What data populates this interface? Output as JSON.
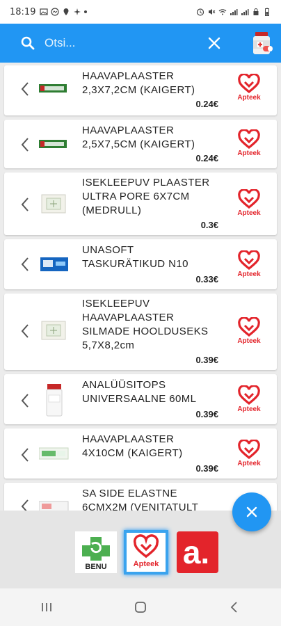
{
  "status_bar": {
    "time": "18:19"
  },
  "search": {
    "placeholder": "Otsi...",
    "value": ""
  },
  "colors": {
    "primary": "#2196f3",
    "apteek_red": "#e3242b",
    "card_bg": "#ffffff"
  },
  "products": [
    {
      "name": "HAAVAPLAASTER\n2,3X7,2CM (KAIGERT)",
      "price": "0.24€",
      "thumb": "green-strip",
      "pharmacy": "Apteek"
    },
    {
      "name": "HAAVAPLAASTER\n2,5X7,5CM (KAIGERT)",
      "price": "0.24€",
      "thumb": "green-strip",
      "pharmacy": "Apteek"
    },
    {
      "name": "ISEKLEEPUV PLAASTER\nULTRA PORE 6X7CM\n(MEDRULL)",
      "price": "0.3€",
      "thumb": "pad",
      "pharmacy": "Apteek"
    },
    {
      "name": "UNASOFT\nTASKURÄTIKUD N10",
      "price": "0.33€",
      "thumb": "blue-pack",
      "pharmacy": "Apteek"
    },
    {
      "name": "ISEKLEEPUV\nHAAVAPLAASTER\nSILMADE HOOLDUSEKS\n5,7X8,2cm",
      "price": "0.39€",
      "thumb": "pad",
      "pharmacy": "Apteek"
    },
    {
      "name": "ANALÜÜSITOPS\nUNIVERSAALNE 60ML",
      "price": "0.39€",
      "thumb": "cup",
      "pharmacy": "Apteek"
    },
    {
      "name": "HAAVAPLAASTER\n4X10CM (KAIGERT)",
      "price": "0.39€",
      "thumb": "green-strip",
      "pharmacy": "Apteek"
    },
    {
      "name": "SA SIDE ELASTNE\n6CMX2M (VENITATULT",
      "price": "",
      "thumb": "bandage",
      "pharmacy": ""
    }
  ],
  "pharmacies": [
    {
      "name": "BENU",
      "selected": false
    },
    {
      "name": "Apteek",
      "selected": true
    },
    {
      "name": "a.",
      "selected": false
    }
  ]
}
